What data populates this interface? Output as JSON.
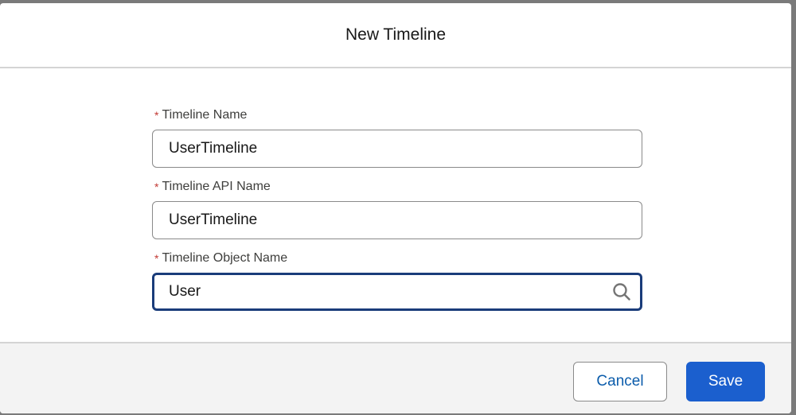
{
  "modal": {
    "title": "New Timeline"
  },
  "form": {
    "required_marker": "*",
    "fields": [
      {
        "label": "Timeline Name",
        "value": "UserTimeline"
      },
      {
        "label": "Timeline API Name",
        "value": "UserTimeline"
      },
      {
        "label": "Timeline Object Name",
        "value": "User",
        "icon": "search-icon"
      }
    ]
  },
  "footer": {
    "cancel_label": "Cancel",
    "save_label": "Save"
  },
  "colors": {
    "primary": "#1b5fce",
    "link": "#0b5cab",
    "required": "#c23934",
    "focus_border": "#1a3c7a"
  }
}
